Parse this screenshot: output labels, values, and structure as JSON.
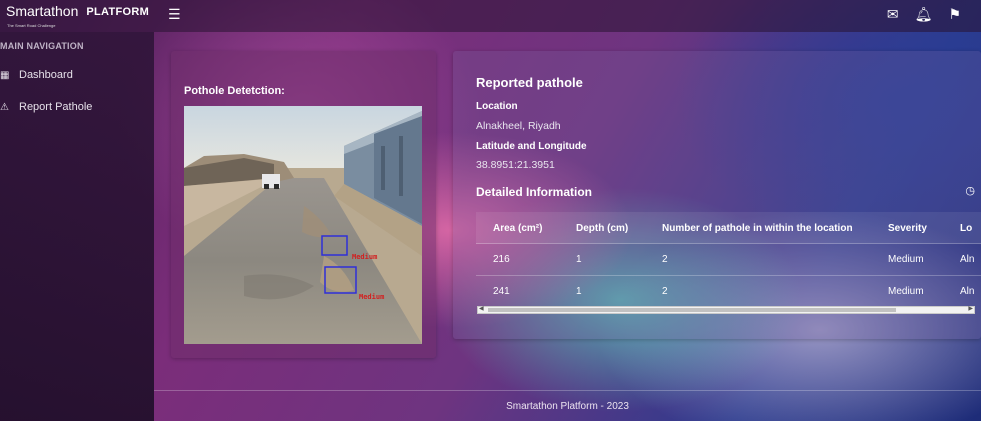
{
  "brand": {
    "logo_text": "Smartathon",
    "tagline": "The Smart Road Challenge",
    "platform_label": "PLATFORM"
  },
  "topbar": {
    "menu_icon": "hamburger-icon",
    "icons": [
      "mail-icon",
      "bell-icon",
      "flag-icon"
    ]
  },
  "sidebar": {
    "title": "MAIN NAVIGATION",
    "items": [
      {
        "label": "Dashboard",
        "icon": "grid-icon"
      },
      {
        "label": "Report Pathole",
        "icon": "warning-icon"
      }
    ]
  },
  "detection": {
    "title": "Pothole Detetction:",
    "boxes": [
      {
        "label": "Medium"
      },
      {
        "label": "Medium"
      }
    ]
  },
  "report": {
    "title": "Reported pathole",
    "location_label": "Location",
    "location_value": "Alnakheel, Riyadh",
    "latlng_label": "Latitude and Longitude",
    "latlng_value": "38.8951:21.3951",
    "detail_title": "Detailed Information",
    "detail_icon": "clock-icon",
    "columns": [
      "Area (cm²)",
      "Depth (cm)",
      "Number of pathole in within the location",
      "Severity",
      "Lo"
    ],
    "rows": [
      [
        "216",
        "1",
        "2",
        "Medium",
        "Aln"
      ],
      [
        "241",
        "1",
        "2",
        "Medium",
        "Aln"
      ]
    ]
  },
  "footer": {
    "text": "Smartathon Platform - 2023"
  },
  "colors": {
    "box_stroke": "#2f2fd8",
    "box_label": "#d22020"
  }
}
